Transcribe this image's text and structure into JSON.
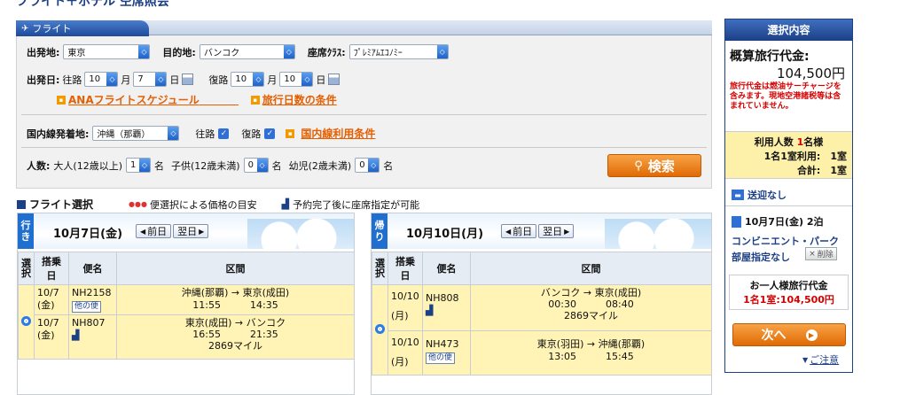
{
  "page": {
    "top_title": "フライト＋ホテル 空席照会"
  },
  "search": {
    "tab_label": "フライト",
    "departure_label": "出発地:",
    "departure_value": "東京",
    "destination_label": "目的地:",
    "destination_value": "バンコク",
    "class_label": "座席ｸﾗｽ:",
    "class_value": "ﾌﾟﾚﾐｱﾑｴｺﾉﾐｰ",
    "date_label": "出発日:",
    "outbound_label": "往路",
    "out_month": "10",
    "out_day": "7",
    "month_unit": "月",
    "day_unit": "日",
    "return_label": "復路",
    "ret_month": "10",
    "ret_day": "10",
    "link_schedule": "ANAフライトスケジュール",
    "link_days": "旅行日数の条件",
    "domestic_label": "国内線発着地:",
    "domestic_value": "沖縄（那覇）",
    "dom_out": "往路",
    "dom_ret": "復路",
    "link_domestic": "国内線利用条件",
    "pax_label": "人数:",
    "adult_label": "大人(12歳以上)",
    "adult_value": "1",
    "unit_person": "名",
    "child_label": "子供(12歳未満)",
    "child_value": "0",
    "infant_label": "幼児(2歳未満)",
    "infant_value": "0",
    "search_button": "検索"
  },
  "legend": {
    "title": "フライト選択",
    "price_guide": "便選択による価格の目安",
    "seat_note": "予約完了後に座席指定が可能"
  },
  "outbound": {
    "tag_line1": "行",
    "tag_line2": "き",
    "date": "10月7日(金)",
    "prev": "前日",
    "next": "翌日",
    "headers": {
      "select1": "選",
      "select2": "択",
      "date": "搭乗日",
      "flight": "便名",
      "route": "区間"
    },
    "rows": [
      {
        "date1": "10/7",
        "date2": "(金)",
        "flight": "NH2158",
        "other": "他の便",
        "from": "沖縄(那覇)",
        "to": "東京(成田)",
        "dep": "11:55",
        "arr": "14:35",
        "miles": ""
      },
      {
        "date1": "10/7",
        "date2": "(金)",
        "flight": "NH807",
        "other": "",
        "from": "東京(成田)",
        "to": "バンコク",
        "dep": "16:55",
        "arr": "21:35",
        "miles": "2869マイル"
      }
    ]
  },
  "return": {
    "tag_line1": "帰",
    "tag_line2": "り",
    "date": "10月10日(月)",
    "prev": "前日",
    "next": "翌日",
    "rows": [
      {
        "date1": "10/10",
        "date2": "(月)",
        "flight": "NH808",
        "other": "",
        "from": "バンコク",
        "to": "東京(成田)",
        "dep": "00:30",
        "arr": "08:40",
        "miles": "2869マイル"
      },
      {
        "date1": "10/10",
        "date2": "(月)",
        "flight": "NH473",
        "other": "他の便",
        "from": "東京(羽田)",
        "to": "沖縄(那覇)",
        "dep": "13:05",
        "arr": "15:45",
        "miles": ""
      }
    ]
  },
  "summary": {
    "header": "選択内容",
    "price_label": "概算旅行代金:",
    "price_value": "104,500円",
    "note": "旅行代金は燃油サーチャージを含みます。現地空港諸税等は含まれていません。",
    "people_label": "利用人数",
    "people_count": "1",
    "people_unit": "名様",
    "room_use": "1名1室利用:　1室",
    "room_total": "合計:　1室",
    "transfer": "送迎なし",
    "hotel_date": "10月7日(金) 2泊",
    "hotel_name": "コンビニエント・パーク",
    "room_assign": "部屋指定なし",
    "delete": "削除",
    "per_person_label": "お一人様旅行代金",
    "per_person_value": "1名1室:104,500円",
    "next_button": "次へ",
    "caution": "ご注意"
  },
  "colors": {
    "accent": "#f08a1c",
    "navy": "#1c3f86",
    "panel": "#f1f1f1"
  }
}
